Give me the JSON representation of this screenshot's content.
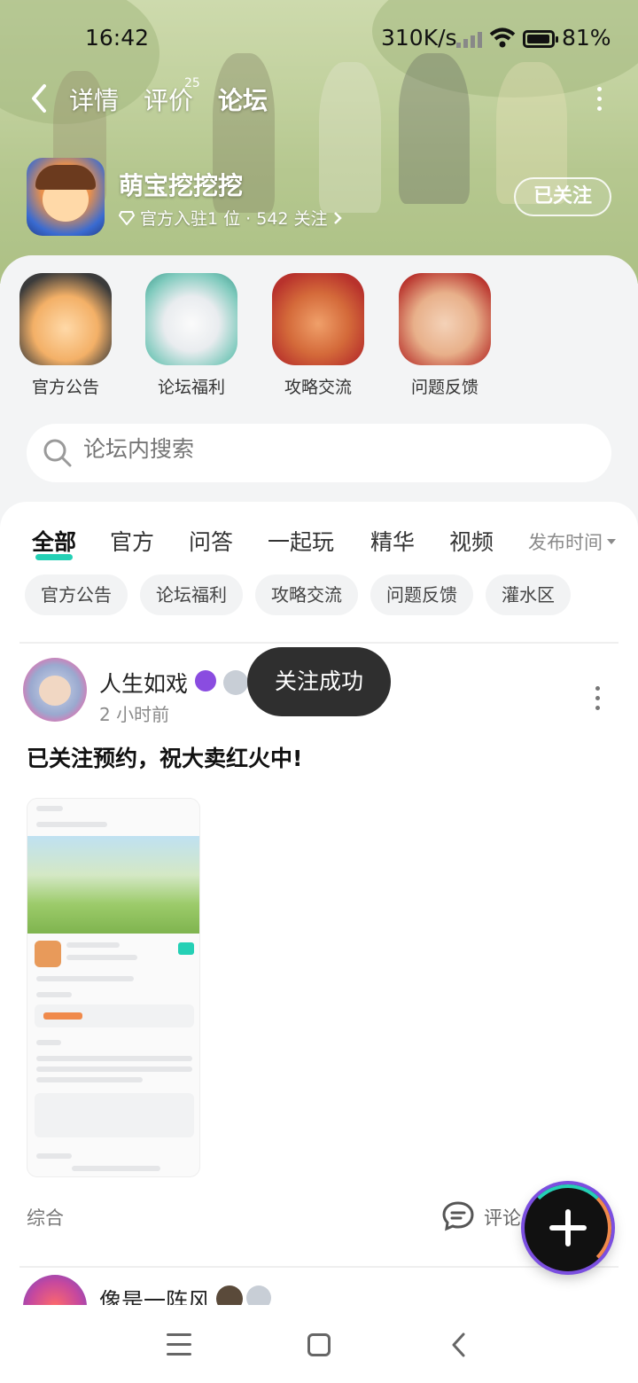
{
  "status_bar": {
    "time": "16:42",
    "net_speed": "310K/s",
    "battery": "81%"
  },
  "nav": {
    "tabs": [
      {
        "label": "详情"
      },
      {
        "label": "评价"
      },
      {
        "label": "论坛"
      }
    ],
    "review_count": "25",
    "active_tab": "论坛"
  },
  "game": {
    "title": "萌宝挖挖挖",
    "meta": "官方入驻1 位 · 542 关注",
    "follow_label": "已关注"
  },
  "categories": [
    {
      "label": "官方公告"
    },
    {
      "label": "论坛福利"
    },
    {
      "label": "攻略交流"
    },
    {
      "label": "问题反馈"
    }
  ],
  "search": {
    "placeholder": "论坛内搜索"
  },
  "feed_tabs": [
    {
      "label": "全部"
    },
    {
      "label": "官方"
    },
    {
      "label": "问答"
    },
    {
      "label": "一起玩"
    },
    {
      "label": "精华"
    },
    {
      "label": "视频"
    }
  ],
  "sort_label": "发布时间",
  "chips": [
    {
      "label": "官方公告"
    },
    {
      "label": "论坛福利"
    },
    {
      "label": "攻略交流"
    },
    {
      "label": "问题反馈"
    },
    {
      "label": "灌水区"
    }
  ],
  "post": {
    "user": "人生如戏",
    "time": "2 小时前",
    "text": "已关注预约，祝大卖红火中!",
    "category": "综合",
    "comment_label": "评论"
  },
  "post2": {
    "user": "像是一阵风"
  },
  "toast": "关注成功",
  "colors": {
    "accent": "#25d0b5",
    "fab": "#111111",
    "toast_bg": "#2f2f2f"
  }
}
